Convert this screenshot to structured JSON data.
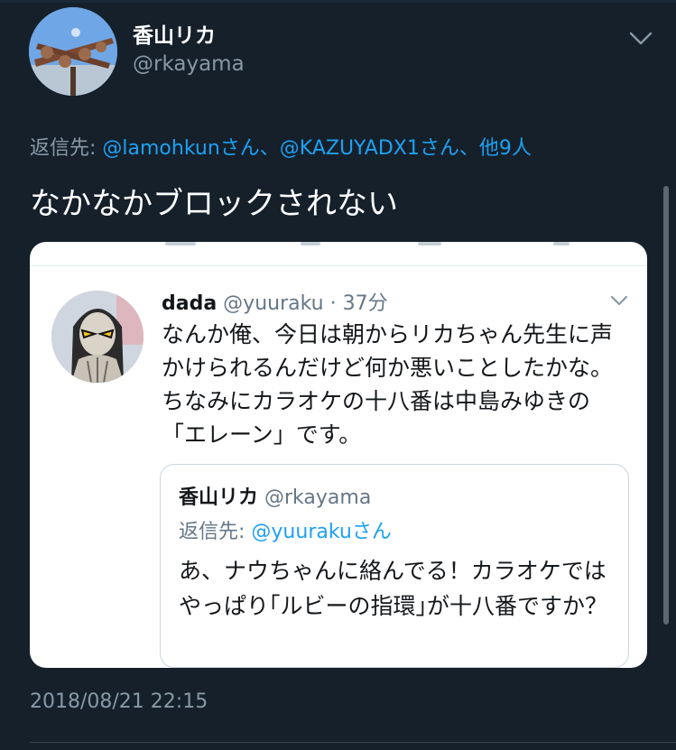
{
  "tweet": {
    "author_name": "香山リカ",
    "author_handle": "@rkayama",
    "reply_prefix": "返信先: ",
    "reply_mentions": "@lamohkunさん、@KAZUYADX1さん、他9人",
    "text": "なかなかブロックされない",
    "timestamp": "2018/08/21 22:15"
  },
  "embedded": {
    "author_name": "dada",
    "author_meta": " @yuuraku · 37分",
    "text": "なんか俺、今日は朝からリカちゃん先生に声かけられるんだけど何か悪いことしたかな。ちなみにカラオケの十八番は中島みゆきの「エレーン」です。",
    "quoted": {
      "author_name": "香山リカ",
      "author_handle": " @rkayama",
      "reply_prefix": "返信先: ",
      "reply_mention": "@yuurakuさん",
      "text": "あ、ナウちゃんに絡んでる！カラオケではやっぱり｢ルビーの指環｣が十八番ですか？"
    }
  },
  "icons": {
    "top_menu": "chevron-down-icon",
    "embedded_menu": "chevron-down-icon"
  },
  "colors": {
    "background": "#15202b",
    "link": "#1da1f2",
    "secondary_text": "#8899a6",
    "card": "#ffffff"
  }
}
